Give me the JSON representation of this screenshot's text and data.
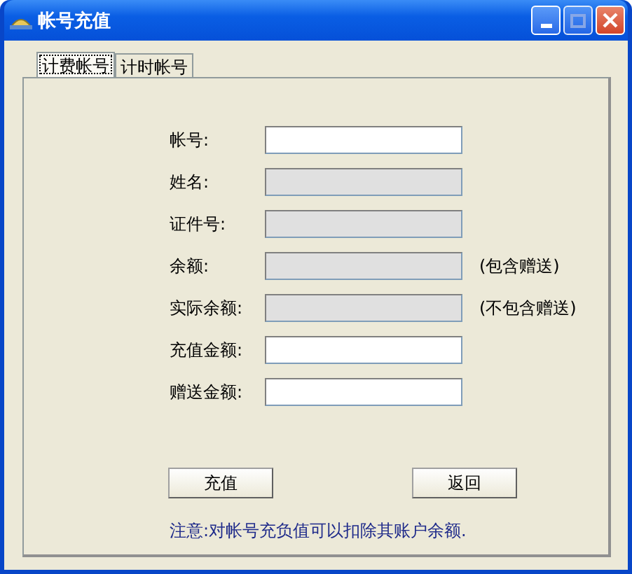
{
  "window": {
    "title": "帐号充值"
  },
  "tabs": [
    {
      "label": "计费帐号",
      "selected": true
    },
    {
      "label": "计时帐号",
      "selected": false
    }
  ],
  "fields": [
    {
      "label": "帐号:",
      "disabled": false
    },
    {
      "label": "姓名:",
      "disabled": true
    },
    {
      "label": "证件号:",
      "disabled": true
    },
    {
      "label": "余额:",
      "disabled": true,
      "note": "(包含赠送)"
    },
    {
      "label": "实际余额:",
      "disabled": true,
      "note": "(不包含赠送)"
    },
    {
      "label": "充值金额:",
      "disabled": false
    },
    {
      "label": "赠送金额:",
      "disabled": false
    }
  ],
  "buttons": [
    "充值",
    "返回"
  ],
  "notice": "注意:对帐号充负值可以扣除其账户余额."
}
